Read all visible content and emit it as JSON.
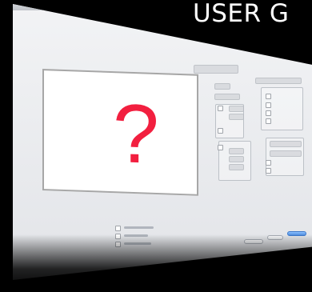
{
  "overlay_title": "USER G",
  "preview_symbol": "?"
}
